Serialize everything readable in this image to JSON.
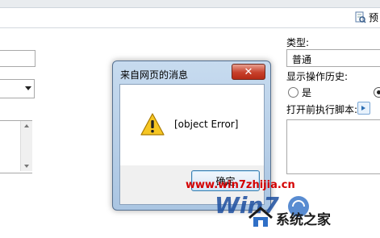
{
  "toolbar": {
    "preview_label": "预"
  },
  "right_form": {
    "type_label": "类型:",
    "type_value": "普通",
    "history_label": "显示操作历史:",
    "yes_label": "是",
    "script_label": "打开前执行脚本:"
  },
  "dialog": {
    "title": "来自网页的消息",
    "close_glyph": "✕",
    "message": "[object Error]",
    "ok_label": "确定"
  },
  "watermark": {
    "url": "www.win7zhijia.cn",
    "logo_text": "Win7",
    "brand": "系统之家"
  }
}
